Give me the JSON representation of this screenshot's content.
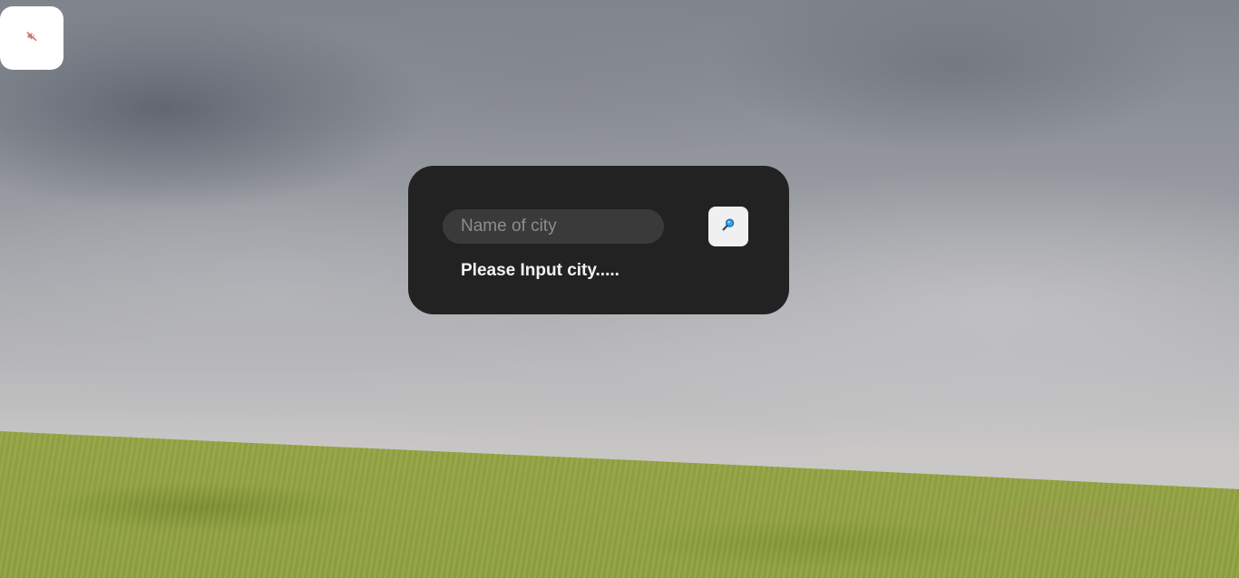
{
  "background": {
    "sky_color": "#989ba1",
    "grass_color": "#98a648"
  },
  "audio": {
    "icon": "muted-speaker-icon",
    "icon_color": "#d9534f"
  },
  "search": {
    "placeholder": "Name of city",
    "value": "",
    "button_icon": "magnifier-icon",
    "button_icon_color": "#2a8fd8"
  },
  "weather": {
    "status": "Please Input city....."
  },
  "colors": {
    "card_background": "#222222",
    "input_background": "#3a3a3a",
    "text": "#f2f2f2"
  }
}
